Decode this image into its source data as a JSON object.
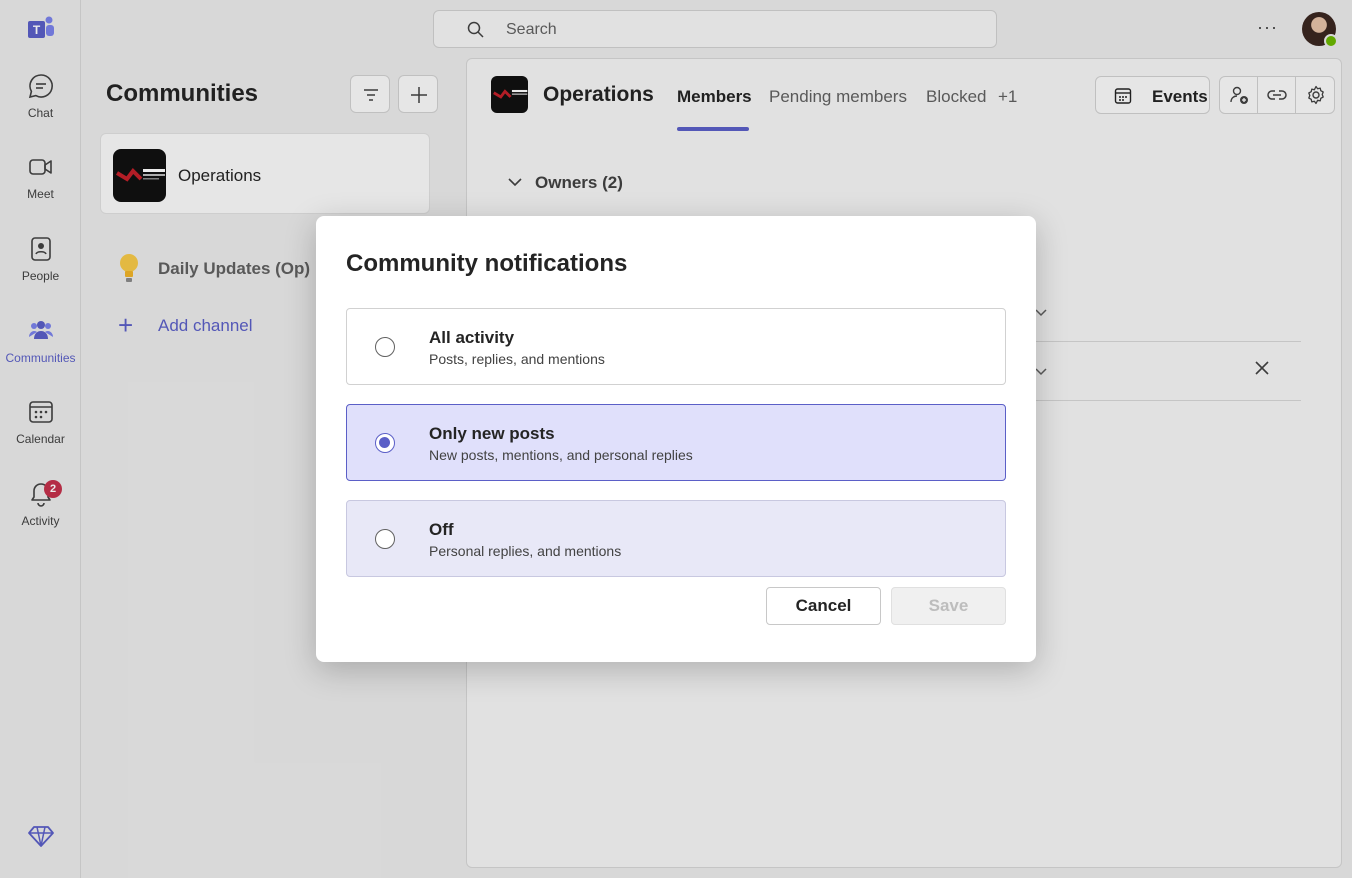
{
  "rail": {
    "items": [
      {
        "label": "Chat",
        "icon": "chat-icon"
      },
      {
        "label": "Meet",
        "icon": "video-icon"
      },
      {
        "label": "People",
        "icon": "people-icon"
      },
      {
        "label": "Communities",
        "icon": "communities-icon",
        "active": true
      },
      {
        "label": "Calendar",
        "icon": "calendar-icon"
      },
      {
        "label": "Activity",
        "icon": "bell-icon",
        "badge": "2"
      }
    ]
  },
  "topbar": {
    "search_placeholder": "Search",
    "more_label": "···"
  },
  "communities": {
    "title": "Communities",
    "selected": {
      "name": "Operations"
    },
    "channels": [
      {
        "name": "Daily Updates (Op)"
      }
    ],
    "add_channel": "Add channel"
  },
  "main": {
    "title": "Operations",
    "tabs": [
      "Members",
      "Pending members",
      "Blocked",
      "+1"
    ],
    "active_tab": "Members",
    "events_label": "Events",
    "owners_label": "Owners (2)"
  },
  "dialog": {
    "title": "Community notifications",
    "options": [
      {
        "title": "All activity",
        "subtitle": "Posts, replies, and mentions",
        "selected": false
      },
      {
        "title": "Only new posts",
        "subtitle": "New posts, mentions, and personal replies",
        "selected": true
      },
      {
        "title": "Off",
        "subtitle": "Personal replies, and mentions",
        "selected": false
      }
    ],
    "cancel_label": "Cancel",
    "save_label": "Save"
  },
  "colors": {
    "accent": "#5b5fc7",
    "badge": "#c4314b",
    "selected_bg": "#e0e0fb"
  }
}
